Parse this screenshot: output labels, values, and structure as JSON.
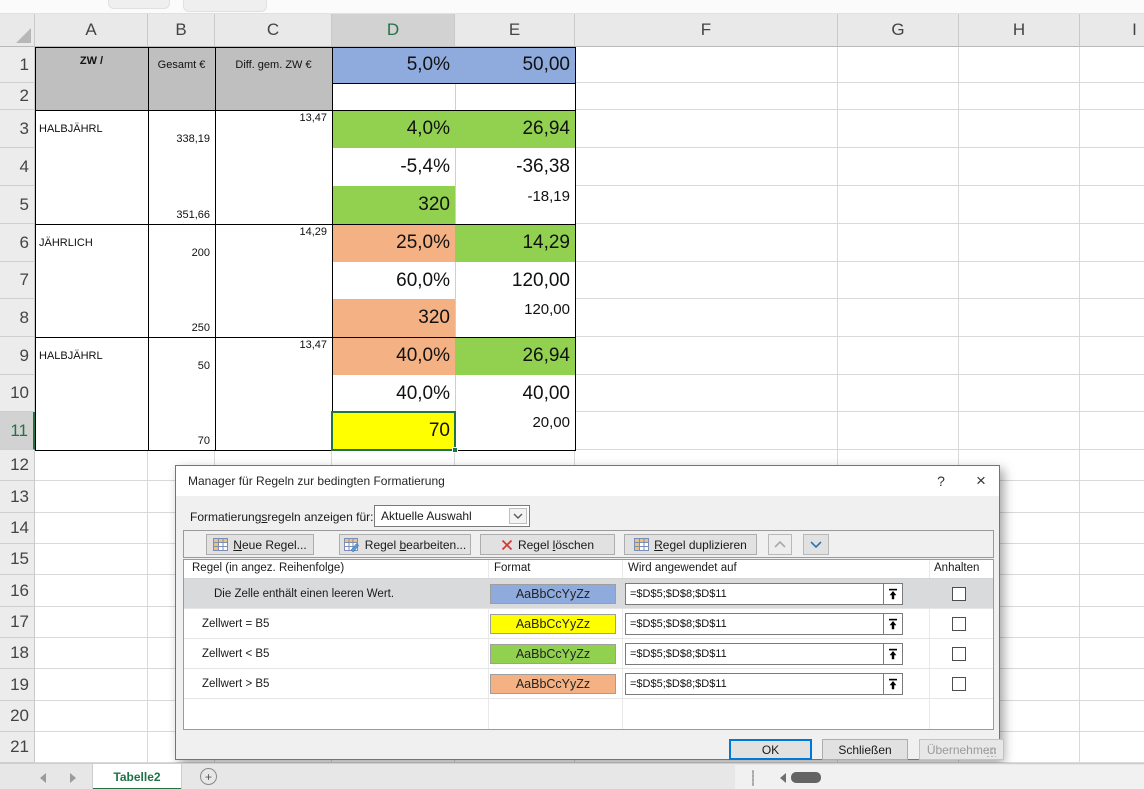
{
  "colors": {
    "blue": "#8FAADC",
    "yellow": "#FFFF00",
    "green": "#92D050",
    "orange": "#F4B183",
    "header_fill": "#BFBFBF",
    "selection_green": "#217346"
  },
  "sheet": {
    "column_headers": [
      "A",
      "B",
      "C",
      "D",
      "E",
      "F",
      "G",
      "H",
      "I"
    ],
    "selected_column": "D",
    "row_headers": [
      "1",
      "2",
      "3",
      "4",
      "5",
      "6",
      "7",
      "8",
      "9",
      "10",
      "11",
      "12",
      "13",
      "14",
      "15",
      "16",
      "17",
      "18",
      "19",
      "20",
      "21"
    ],
    "selected_row": "11",
    "active_cell": "D11",
    "cells": [
      {
        "ref": "A1",
        "rowspan": 2,
        "text": "ZW /",
        "fill": "header_fill",
        "style": "small bold a-center vtop8"
      },
      {
        "ref": "B1",
        "rowspan": 2,
        "text": "Gesamt €",
        "fill": "header_fill",
        "style": "small a-center vtop12"
      },
      {
        "ref": "C1",
        "rowspan": 2,
        "text": "Diff. gem. ZW €",
        "fill": "header_fill",
        "style": "small a-center vtop12"
      },
      {
        "ref": "D1",
        "text": "5,0%",
        "fill": "blue",
        "style": "large a-right v-mid"
      },
      {
        "ref": "E1",
        "text": "50,00",
        "fill": "blue",
        "style": "large a-right v-mid"
      },
      {
        "ref": "A3",
        "text": "HALBJÄHRL",
        "style": "small a-left v-mid"
      },
      {
        "ref": "B3",
        "text": "338,19",
        "style": "small a-right v-bottom"
      },
      {
        "ref": "C3",
        "text": "13,47",
        "style": "small a-right v-top"
      },
      {
        "ref": "D3",
        "text": "4,0%",
        "fill": "green",
        "style": "large a-right v-mid"
      },
      {
        "ref": "E3",
        "text": "26,94",
        "fill": "green",
        "style": "large a-right v-mid"
      },
      {
        "ref": "D4",
        "text": "-5,4%",
        "style": "large a-right v-mid"
      },
      {
        "ref": "E4",
        "text": "-36,38",
        "style": "large a-right v-mid"
      },
      {
        "ref": "B5",
        "text": "351,66",
        "style": "small a-right v-bottom"
      },
      {
        "ref": "D5",
        "text": "320",
        "fill": "green",
        "style": "large a-right v-mid"
      },
      {
        "ref": "E5",
        "text": "-18,19",
        "style": "med a-right v-top"
      },
      {
        "ref": "A6",
        "text": "JÄHRLICH",
        "style": "small a-left v-mid"
      },
      {
        "ref": "B6",
        "text": "200",
        "style": "small a-right v-bottom"
      },
      {
        "ref": "C6",
        "text": "14,29",
        "style": "small a-right v-top"
      },
      {
        "ref": "D6",
        "text": "25,0%",
        "fill": "orange",
        "style": "large a-right v-mid"
      },
      {
        "ref": "E6",
        "text": "14,29",
        "fill": "green",
        "style": "large a-right v-mid"
      },
      {
        "ref": "D7",
        "text": "60,0%",
        "style": "large a-right v-mid"
      },
      {
        "ref": "E7",
        "text": "120,00",
        "style": "large a-right v-mid"
      },
      {
        "ref": "B8",
        "text": "250",
        "style": "small a-right v-bottom"
      },
      {
        "ref": "D8",
        "text": "320",
        "fill": "orange",
        "style": "large a-right v-mid"
      },
      {
        "ref": "E8",
        "text": "120,00",
        "style": "med a-right v-top"
      },
      {
        "ref": "A9",
        "text": "HALBJÄHRL",
        "style": "small a-left v-mid"
      },
      {
        "ref": "B9",
        "text": "50",
        "style": "small a-right v-bottom"
      },
      {
        "ref": "C9",
        "text": "13,47",
        "style": "small a-right v-top"
      },
      {
        "ref": "D9",
        "text": "40,0%",
        "fill": "orange",
        "style": "large a-right v-mid"
      },
      {
        "ref": "E9",
        "text": "26,94",
        "fill": "green",
        "style": "large a-right v-mid"
      },
      {
        "ref": "D10",
        "text": "40,0%",
        "style": "large a-right v-mid"
      },
      {
        "ref": "E10",
        "text": "40,00",
        "style": "large a-right v-mid"
      },
      {
        "ref": "B11",
        "text": "70",
        "style": "small a-right v-bottom"
      },
      {
        "ref": "D11",
        "text": "70",
        "fill": "yellow",
        "style": "large a-right v-mid"
      },
      {
        "ref": "E11",
        "text": "20,00",
        "style": "med a-right v-top"
      }
    ],
    "tab_bar": {
      "active_tab": "Tabelle2",
      "add_sheet_glyph": "+"
    }
  },
  "dialog": {
    "title": "Manager für Regeln zur bedingten Formatierung",
    "help_glyph": "?",
    "close_glyph": "×",
    "show_rules_label_parts": {
      "pre": "Formatierung",
      "key": "s",
      "post": "regeln anzeigen für:"
    },
    "show_rules_value": "Aktuelle Auswahl",
    "toolbar": {
      "new_parts": {
        "pre": "",
        "key": "N",
        "post": "eue Regel..."
      },
      "edit_parts": {
        "pre": "Regel ",
        "key": "b",
        "post": "earbeiten..."
      },
      "delete_parts": {
        "pre": "Regel ",
        "key": "l",
        "post": "öschen"
      },
      "duplicate_parts": {
        "pre": "",
        "key": "R",
        "post": "egel duplizieren"
      }
    },
    "table_headers": {
      "rule": "Regel (in angez. Reihenfolge)",
      "format": "Format",
      "applies": "Wird angewendet auf",
      "stop": "Anhalten"
    },
    "format_preview_text": "AaBbCcYyZz",
    "rules": [
      {
        "condition": "Die Zelle enthält einen leeren Wert.",
        "fill": "#8FAADC",
        "applies_to": "=$D$5;$D$8;$D$11",
        "selected": true,
        "stop_checked": false
      },
      {
        "condition": "Zellwert = B5",
        "fill": "#FFFF00",
        "applies_to": "=$D$5;$D$8;$D$11",
        "selected": false,
        "stop_checked": false
      },
      {
        "condition": "Zellwert < B5",
        "fill": "#92D050",
        "applies_to": "=$D$5;$D$8;$D$11",
        "selected": false,
        "stop_checked": false
      },
      {
        "condition": "Zellwert > B5",
        "fill": "#F4B183",
        "applies_to": "=$D$5;$D$8;$D$11",
        "selected": false,
        "stop_checked": false
      }
    ],
    "footer": {
      "ok": "OK",
      "close": "Schließen",
      "apply": "Übernehmen"
    }
  }
}
